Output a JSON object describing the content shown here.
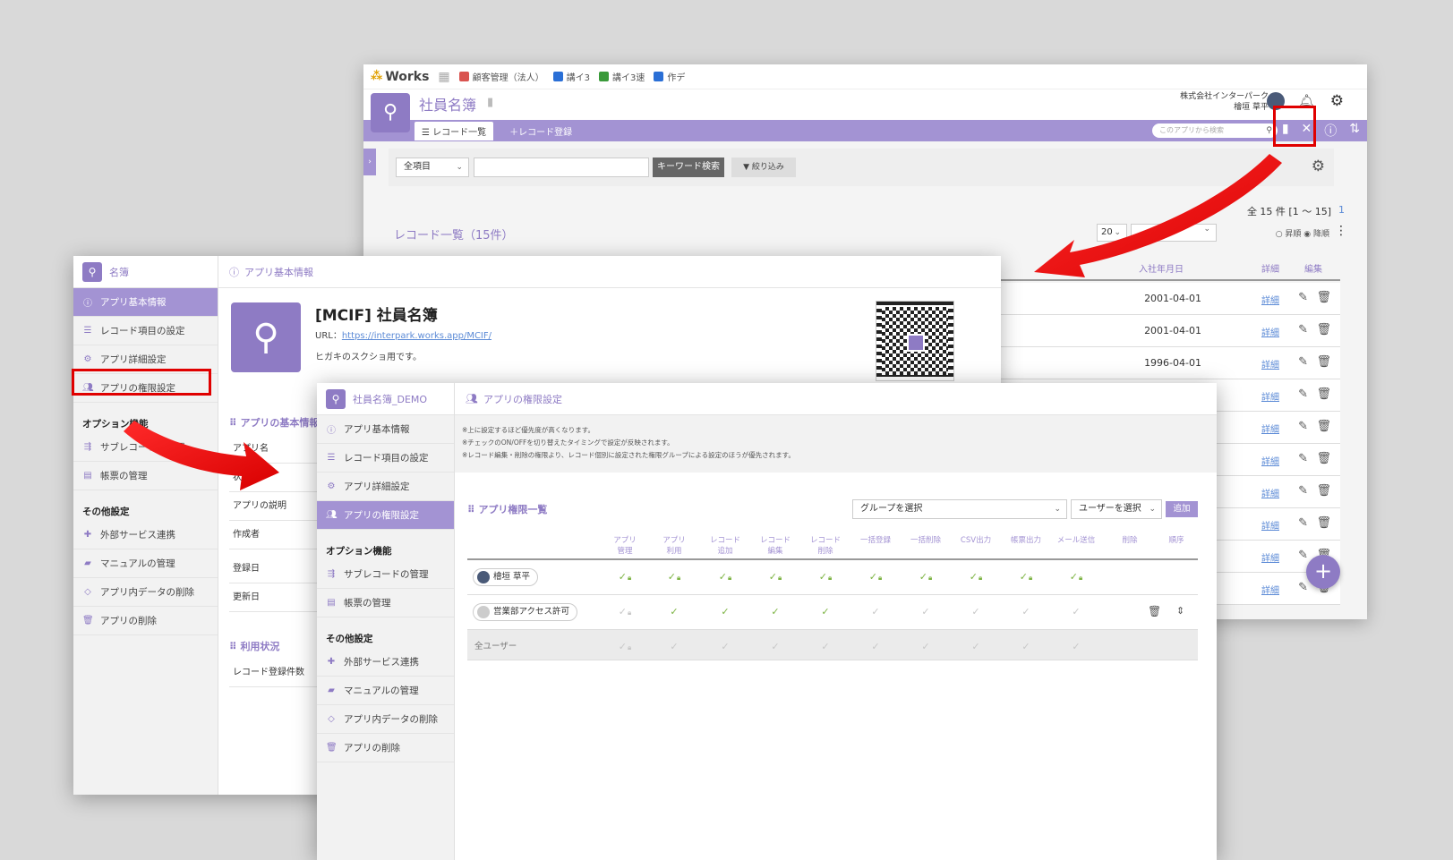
{
  "w1": {
    "logo": "Works",
    "apps": [
      {
        "label": "顧客管理（法人）",
        "color": "#d9534f"
      },
      {
        "label": "講イ3",
        "color": "#2a6fd6"
      },
      {
        "label": "講イ3速",
        "color": "#3a9a3a"
      },
      {
        "label": "作デ",
        "color": "#2a6fd6"
      }
    ],
    "app_title": "社員名簿",
    "company": "株式会社インターパーク",
    "user": "檜垣 草平",
    "tabs": {
      "list": "レコード一覧",
      "register": "レコード登録"
    },
    "search_placeholder": "このアプリから検索",
    "filter": {
      "select": "全項目",
      "keyword_button": "キーワード検索",
      "filter_button": "絞り込み"
    },
    "count": "全 15 件 [1 〜 15]",
    "page": "1",
    "list_title": "レコード一覧（15件）",
    "per_page": "20",
    "order": "○ 昇順  ◉ 降順",
    "columns": {
      "date": "入社年月日",
      "detail": "詳細",
      "edit": "編集"
    },
    "rows": [
      {
        "date": "2001-04-01",
        "detail": "詳細"
      },
      {
        "date": "2001-04-01",
        "detail": "詳細"
      },
      {
        "date": "1996-04-01",
        "detail": "詳細"
      },
      {
        "date": "",
        "detail": "詳細"
      },
      {
        "date": "",
        "detail": "詳細"
      },
      {
        "date": "",
        "detail": "詳細"
      },
      {
        "date": "",
        "detail": "詳細"
      },
      {
        "date": "",
        "detail": "詳細"
      },
      {
        "date": "",
        "detail": "詳細"
      },
      {
        "date": "",
        "detail": "詳細"
      }
    ],
    "fab": "+"
  },
  "w2": {
    "sidebar_title": "名簿",
    "items": [
      "アプリ基本情報",
      "レコード項目の設定",
      "アプリ詳細設定",
      "アプリの権限設定"
    ],
    "option_section": "オプション機能",
    "option_items": [
      "サブレコードの管理",
      "帳票の管理"
    ],
    "other_section": "その他設定",
    "other_items": [
      "外部サービス連携",
      "マニュアルの管理",
      "アプリ内データの削除",
      "アプリの削除"
    ],
    "main_title": "アプリ基本情報",
    "app_name": "[MCIF] 社員名簿",
    "url_label": "URL：",
    "url": "https://interpark.works.app/MCIF/",
    "description": "ヒガキのスクショ用です。",
    "basic_section": "アプリの基本情報",
    "basic_rows": [
      "アプリ名",
      "状態",
      "アプリの説明",
      "作成者",
      "登録日",
      "更新日"
    ],
    "usage_section": "利用状況",
    "usage_rows": [
      "レコード登録件数"
    ]
  },
  "w3": {
    "sidebar_title": "社員名簿_DEMO",
    "items": [
      "アプリ基本情報",
      "レコード項目の設定",
      "アプリ詳細設定",
      "アプリの権限設定"
    ],
    "option_section": "オプション機能",
    "option_items": [
      "サブレコードの管理",
      "帳票の管理"
    ],
    "other_section": "その他設定",
    "other_items": [
      "外部サービス連携",
      "マニュアルの管理",
      "アプリ内データの削除",
      "アプリの削除"
    ],
    "main_title": "アプリの権限設定",
    "notes": [
      "※上に設定するほど優先度が高くなります。",
      "※チェックのON/OFFを切り替えたタイミングで設定が反映されます。",
      "※レコード編集・削除の権限より、レコード個別に設定された権限グループによる設定のほうが優先されます。"
    ],
    "perm_title": "アプリ権限一覧",
    "group_select": "グループを選択",
    "user_select": "ユーザーを選択",
    "add_button": "追加",
    "columns": [
      "アプリ\n管理",
      "アプリ\n利用",
      "レコード\n追加",
      "レコード\n編集",
      "レコード\n削除",
      "一括登録",
      "一括削除",
      "CSV出力",
      "帳票出力",
      "メール送信",
      "削除",
      "順序"
    ],
    "rows": [
      {
        "name": "檜垣 草平",
        "checks": [
          2,
          2,
          2,
          2,
          2,
          2,
          2,
          2,
          2,
          2
        ]
      },
      {
        "name": "営業部アクセス許可",
        "checks": [
          3,
          1,
          1,
          1,
          1,
          0,
          0,
          0,
          0,
          0
        ]
      },
      {
        "name": "全ユーザー",
        "checks": [
          3,
          0,
          0,
          0,
          0,
          0,
          0,
          0,
          0,
          0
        ]
      }
    ]
  },
  "colors": {
    "accent": "#8e7bc4",
    "tabbar": "#a393d3",
    "check_on": "#7cb342",
    "highlight": "#e00000"
  }
}
